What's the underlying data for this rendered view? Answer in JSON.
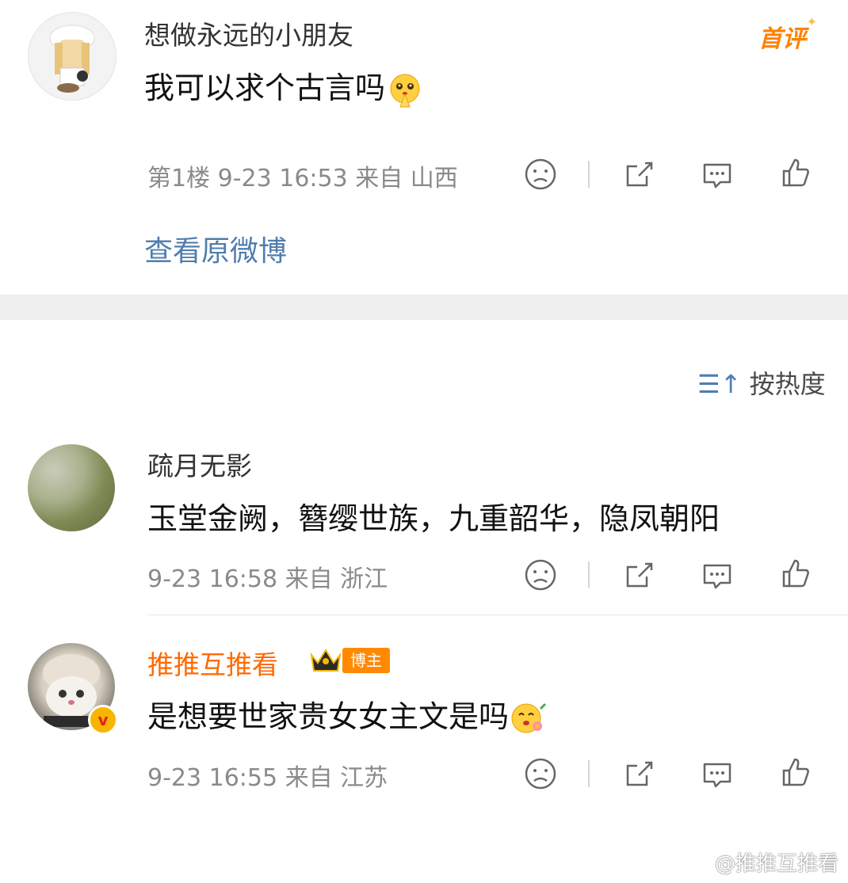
{
  "comments": [
    {
      "user": "想做永远的小朋友",
      "text": "我可以求个古言吗",
      "meta": "第1楼 9-23 16:53 来自 山西",
      "badge": "首评",
      "link": "查看原微博"
    },
    {
      "user": "疏月无影",
      "text": "玉堂金阙，簪缨世族，九重韶华，隐凤朝阳",
      "meta": "9-23 16:58 来自 浙江"
    },
    {
      "user": "推推互推看",
      "tag": "博主",
      "verified": "v",
      "text": "是想要世家贵女女主文是吗",
      "meta": "9-23 16:55 来自 江苏"
    }
  ],
  "sort": {
    "label": "按热度"
  },
  "watermark": "@推推互推看",
  "colors": {
    "link": "#507daf",
    "blogger_name": "#ff6a00",
    "badge": "#ff8200",
    "meta": "#8a8a8a"
  },
  "icons": [
    "sad-face-icon",
    "share-icon",
    "comment-icon",
    "like-icon",
    "sort-icon",
    "crown-icon",
    "pray-emoji-icon",
    "flower-emoji-icon"
  ]
}
